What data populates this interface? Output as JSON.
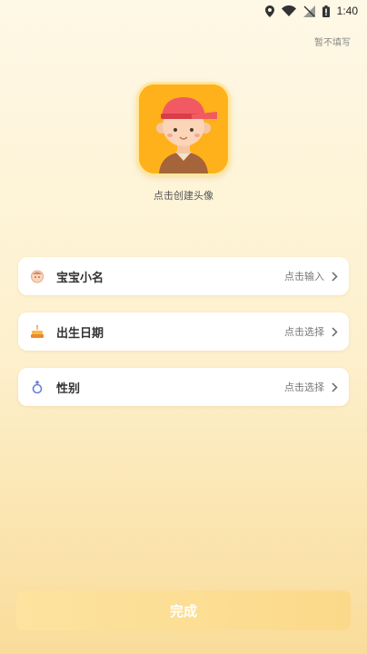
{
  "status_bar": {
    "time": "1:40"
  },
  "header": {
    "skip_label": "暂不填写"
  },
  "avatar": {
    "caption": "点击创建头像"
  },
  "form": {
    "items": [
      {
        "label": "宝宝小名",
        "hint": "点击输入",
        "icon": "baby-face-icon"
      },
      {
        "label": "出生日期",
        "hint": "点击选择",
        "icon": "cake-icon"
      },
      {
        "label": "性别",
        "hint": "点击选择",
        "icon": "gender-icon"
      }
    ]
  },
  "footer": {
    "done_label": "完成"
  },
  "colors": {
    "avatar_bg": "#ffb11c",
    "cap": "#f25a63",
    "button": "#fbd98a"
  }
}
